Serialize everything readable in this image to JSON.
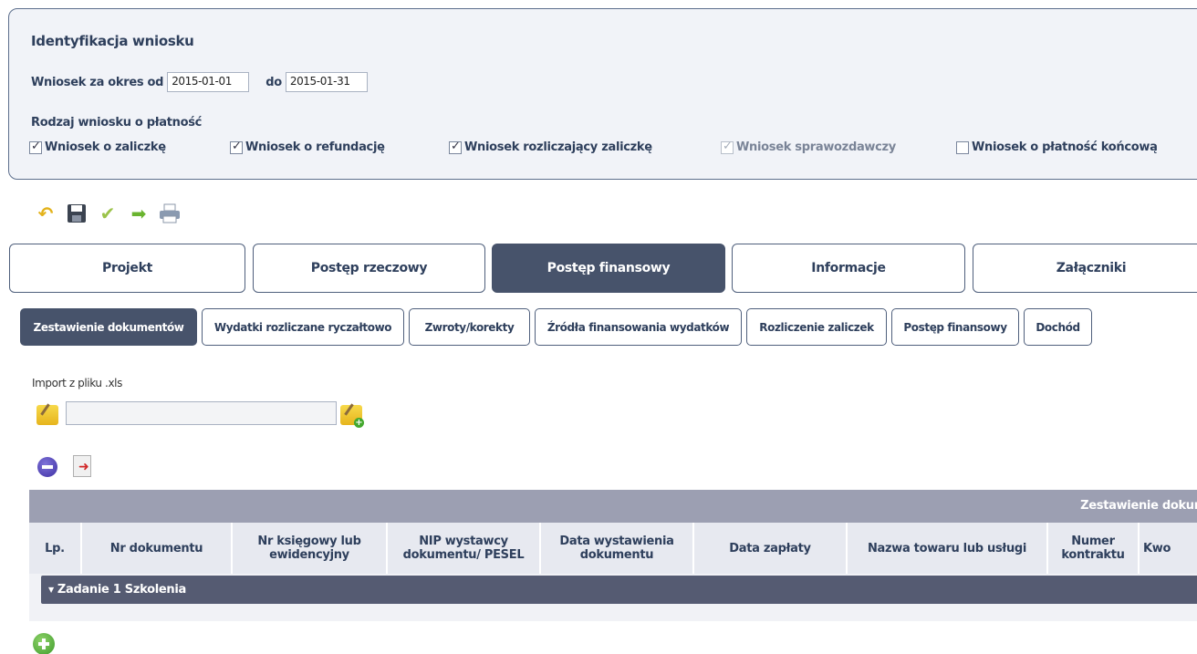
{
  "identification": {
    "title": "Identyfikacja wniosku",
    "period_from_label": "Wniosek za okres od",
    "period_from_value": "2015-01-01",
    "period_to_label": "do",
    "period_to_value": "2015-01-31",
    "type_label": "Rodzaj wniosku o płatność",
    "types": [
      {
        "label": "Wniosek o zaliczkę",
        "checked": true,
        "enabled": true
      },
      {
        "label": "Wniosek o refundację",
        "checked": true,
        "enabled": true
      },
      {
        "label": "Wniosek rozliczający zaliczkę",
        "checked": true,
        "enabled": true
      },
      {
        "label": "Wniosek sprawozdawczy",
        "checked": true,
        "enabled": false
      },
      {
        "label": "Wniosek o płatność końcową",
        "checked": false,
        "enabled": true
      }
    ]
  },
  "toolbar": {
    "icons": [
      "undo-icon",
      "save-icon",
      "check-icon",
      "forward-arrow-icon",
      "print-icon"
    ]
  },
  "main_tabs": [
    {
      "label": "Projekt",
      "active": false
    },
    {
      "label": "Postęp rzeczowy",
      "active": false
    },
    {
      "label": "Postęp finansowy",
      "active": true
    },
    {
      "label": "Informacje",
      "active": false
    },
    {
      "label": "Załączniki",
      "active": false
    }
  ],
  "sub_tabs": [
    {
      "label": "Zestawienie dokumentów",
      "active": true
    },
    {
      "label": "Wydatki rozliczane ryczałtowo",
      "active": false
    },
    {
      "label": "Zwroty/korekty",
      "active": false
    },
    {
      "label": "Źródła finansowania wydatków",
      "active": false
    },
    {
      "label": "Rozliczenie zaliczek",
      "active": false
    },
    {
      "label": "Postęp finansowy",
      "active": false
    },
    {
      "label": "Dochód",
      "active": false
    }
  ],
  "import": {
    "label": "Import z pliku .xls",
    "value": ""
  },
  "table": {
    "band_title": "Zestawienie dokum",
    "columns": [
      "Lp.",
      "Nr dokumentu",
      "Nr księgowy lub\newidencyjny",
      "NIP wystawcy\ndokumentu/ PESEL",
      "Data wystawienia\ndokumentu",
      "Data zapłaty",
      "Nazwa towaru lub usługi",
      "Numer\nkontraktu",
      "Kwo"
    ],
    "group_row": "Zadanie 1 Szkolenia"
  },
  "colors": {
    "active_tab": "#47536b",
    "border": "#4f5f7c",
    "table_band": "#9c9fb2",
    "group_bar": "#555b72"
  }
}
